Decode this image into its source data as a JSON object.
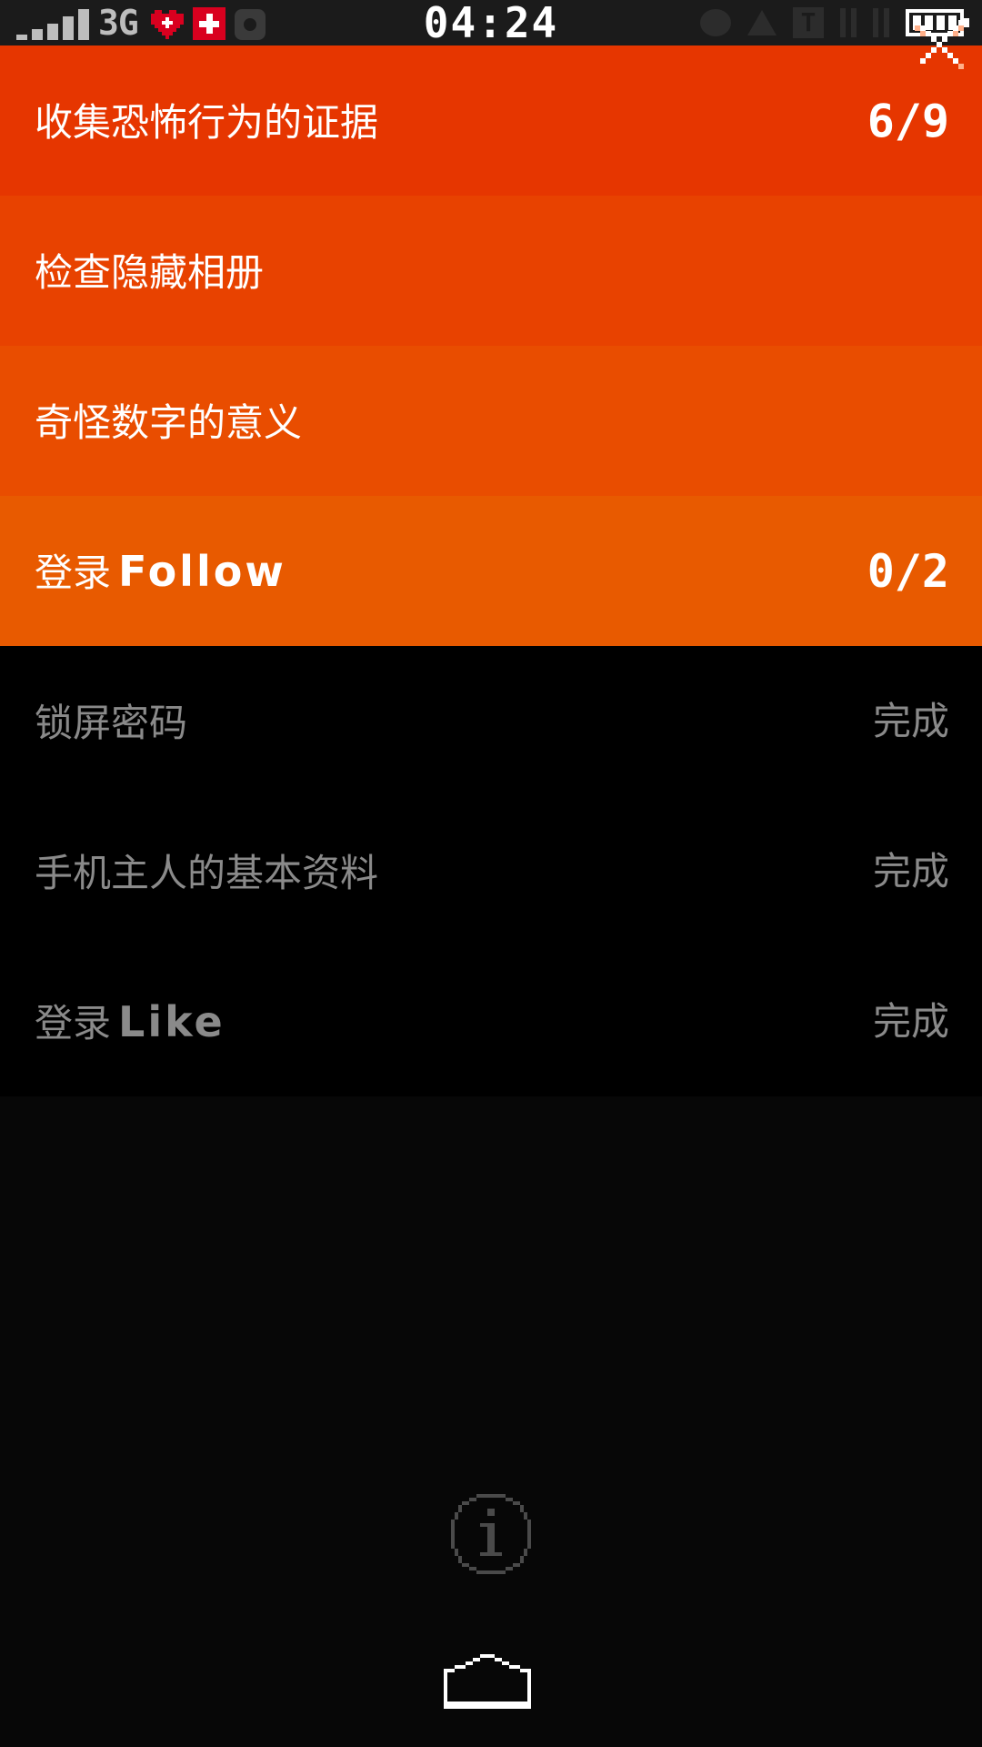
{
  "status_bar": {
    "network": "3G",
    "time": "04:24"
  },
  "tasks": [
    {
      "label": "收集恐怖行为的证据",
      "latin": "",
      "status": "6/9",
      "state": "active",
      "color": "#e63600"
    },
    {
      "label": "检查隐藏相册",
      "latin": "",
      "status": "",
      "state": "active",
      "color": "#e84200"
    },
    {
      "label": "奇怪数字的意义",
      "latin": "",
      "status": "",
      "state": "active",
      "color": "#e94d00"
    },
    {
      "label": "登录",
      "latin": "Follow",
      "status": "0/2",
      "state": "active",
      "color": "#e85a00"
    },
    {
      "label": "锁屏密码",
      "latin": "",
      "status": "完成",
      "state": "done",
      "color": "#000000"
    },
    {
      "label": "手机主人的基本资料",
      "latin": "",
      "status": "完成",
      "state": "done",
      "color": "#000000"
    },
    {
      "label": "登录",
      "latin": "Like",
      "status": "完成",
      "state": "done",
      "color": "#000000"
    }
  ],
  "icons": {
    "close": "close-icon",
    "info": "info-icon",
    "home": "home-icon"
  },
  "colors": {
    "active_text": "#ffffff",
    "done_text": "#8a8a8a",
    "background": "#000000"
  }
}
